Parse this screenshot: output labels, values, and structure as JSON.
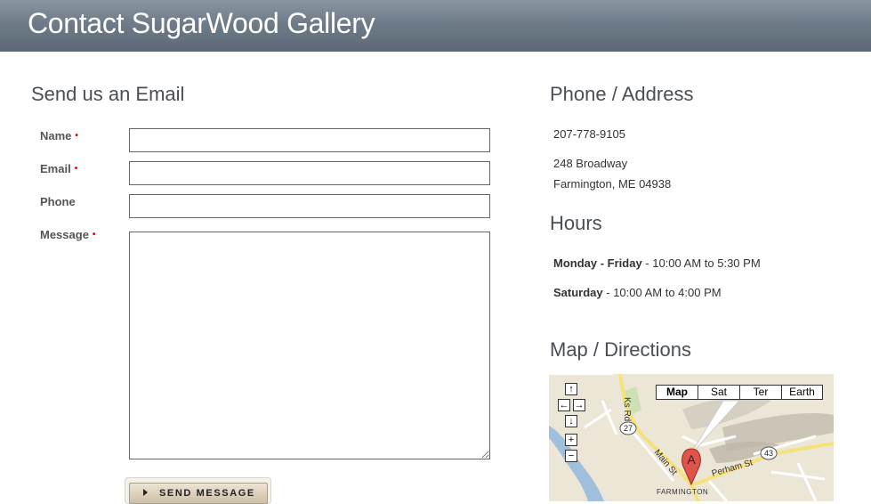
{
  "header": {
    "title": "Contact SugarWood Gallery"
  },
  "form": {
    "title": "Send us an Email",
    "required_marker": "•",
    "fields": {
      "name": {
        "label": "Name",
        "value": "",
        "required": true
      },
      "email": {
        "label": "Email",
        "value": "",
        "required": true
      },
      "phone": {
        "label": "Phone",
        "value": "",
        "required": false
      },
      "message": {
        "label": "Message",
        "value": "",
        "required": true
      }
    },
    "submit_label": "SEND MESSAGE"
  },
  "contact": {
    "title": "Phone / Address",
    "phone": "207-778-9105",
    "address_line1": "248 Broadway",
    "address_line2": "Farmington, ME 04938"
  },
  "hours": {
    "title": "Hours",
    "rows": [
      {
        "days": "Monday - Friday",
        "time": " - 10:00 AM to 5:30 PM"
      },
      {
        "days": "Saturday",
        "time": " - 10:00 AM to 4:00 PM"
      }
    ]
  },
  "map": {
    "title": "Map / Directions",
    "types": [
      "Map",
      "Sat",
      "Ter",
      "Earth"
    ],
    "active_type": "Map",
    "pan_up": "↑",
    "pan_left": "←",
    "pan_right": "→",
    "pan_down": "↓",
    "zoom_in": "+",
    "zoom_out": "−",
    "labels": {
      "road_north": "Ks Rd",
      "main_st": "Main St",
      "perham_st": "Perham St",
      "route_27": "27",
      "route_43": "43",
      "town": "FARMINGTON",
      "marker": "A"
    },
    "colors": {
      "water": "#9fbfdc",
      "road": "#f6e27a",
      "marker": "#e0534a"
    }
  }
}
